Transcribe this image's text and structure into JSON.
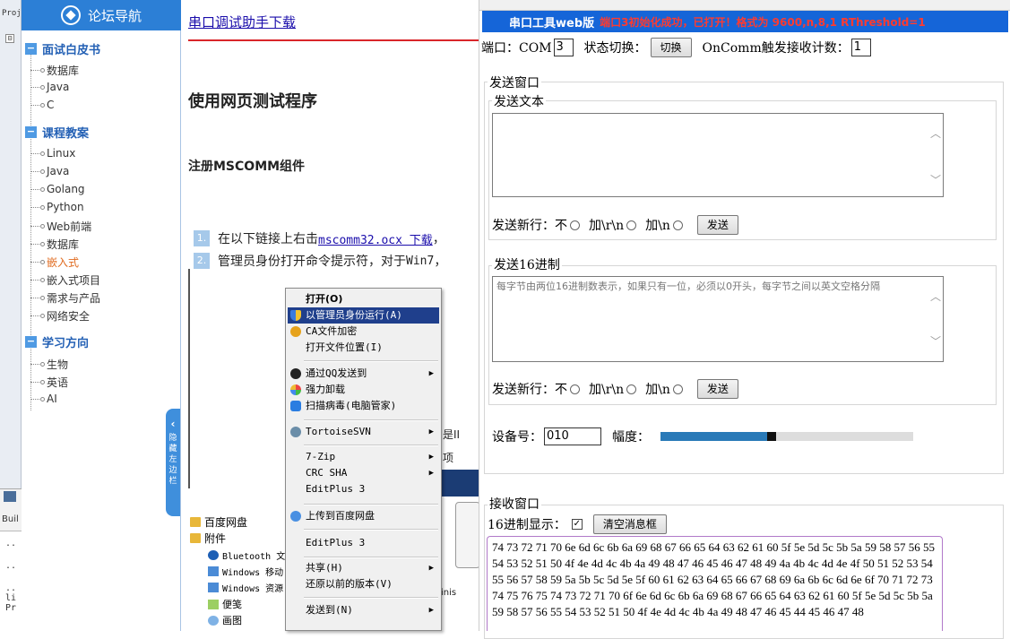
{
  "ide": {
    "panel_tab_top": "Proj",
    "build_tab": "Buil",
    "bottom_rows": [
      "..",
      "..",
      "..",
      "li",
      "Pr"
    ]
  },
  "sidebar": {
    "title": "论坛导航",
    "categories": [
      {
        "label": "面试白皮书",
        "items": [
          "数据库",
          "Java",
          "C"
        ]
      },
      {
        "label": "课程教案",
        "items": [
          "Linux",
          "Java",
          "Golang",
          "Python",
          "Web前端",
          "数据库",
          "嵌入式",
          "嵌入式项目",
          "需求与产品",
          "网络安全"
        ]
      },
      {
        "label": "学习方向",
        "items": [
          "生物",
          "英语",
          "AI"
        ]
      }
    ],
    "active_item": "嵌入式",
    "toggle_label": "隐藏左边栏"
  },
  "article": {
    "download_link": "串口调试助手下载",
    "heading": "使用网页测试程序",
    "subheading": "注册MSCOMM组件",
    "steps": [
      {
        "num": "1.",
        "text": "在以下链接上右击",
        "link": "mscomm32.ocx 下载",
        "tail": "，"
      },
      {
        "num": "2.",
        "text": "管理员身份打开命令提示符，对于",
        "code": "Win7",
        "tail": "，"
      }
    ],
    "fragments": {
      "f1": "是II",
      "f2": "项",
      "f3": "inis"
    }
  },
  "explorer": {
    "items": [
      "百度网盘",
      "附件",
      "Bluetooth 文",
      "Windows 移动",
      "Windows 资源",
      "便笺",
      "画图"
    ]
  },
  "context_menu": {
    "items": [
      {
        "label": "打开(O)",
        "bold": true
      },
      {
        "label": "以管理员身份运行(A)",
        "icon": "shield-icon",
        "highlighted": true
      },
      {
        "label": "CA文件加密",
        "icon": "key-icon"
      },
      {
        "label": "打开文件位置(I)"
      },
      {
        "label": "通过QQ发送到",
        "icon": "qq-icon",
        "submenu": true
      },
      {
        "label": "强力卸载",
        "icon": "uninstall-icon"
      },
      {
        "label": "扫描病毒(电脑管家)",
        "icon": "scan-icon"
      },
      {
        "label": "TortoiseSVN",
        "icon": "svn-icon",
        "submenu": true
      },
      {
        "label": "7-Zip",
        "submenu": true
      },
      {
        "label": "CRC SHA",
        "submenu": true
      },
      {
        "label": "EditPlus 3"
      },
      {
        "label": "上传到百度网盘",
        "icon": "cloud-icon"
      },
      {
        "label": "EditPlus 3"
      },
      {
        "label": "共享(H)",
        "submenu": true
      },
      {
        "label": "还原以前的版本(V)"
      },
      {
        "label": "发送到(N)",
        "submenu": true
      }
    ]
  },
  "tool": {
    "title": "串口工具web版",
    "status": "端口3初始化成功，已打开！格式为 9600,n,8,1 RThreshold=1",
    "port_label": "端口：COM",
    "port_value": "3",
    "toggle_label": "状态切换：",
    "toggle_button": "切换",
    "oncomm_label": "OnComm触发接收计数：",
    "oncomm_value": "1",
    "send_window": "发送窗口",
    "send_text_legend": "发送文本",
    "send_text_value": "",
    "newline_label": "发送新行：",
    "newline_opts": [
      "不",
      "加\\r\\n",
      "加\\n"
    ],
    "send_button": "发送",
    "hex_legend": "发送16进制",
    "hex_placeholder": "每字节由两位16进制数表示，如果只有一位，必须以0开头，每字节之间以英文空格分隔",
    "device_label": "设备号：",
    "device_value": "010",
    "amplitude_label": "幅度：",
    "amplitude_fraction": 0.44,
    "recv_window": "接收窗口",
    "hex_display_label": "16进制显示：",
    "hex_display_checked": true,
    "clear_button": "清空消息框",
    "recv_text": "74 73 72 71 70 6e 6d 6c 6b 6a 69 68 67 66 65 64 63 62 61 60 5f 5e 5d 5c 5b 5a 59 58 57 56 55 54 53 52 51 50 4f 4e 4d 4c 4b 4a 49 48 47 46 45 46 47 48 49 4a 4b 4c 4d 4e 4f 50 51 52 53 54 55 56 57 58 59 5a 5b 5c 5d 5e 5f 60 61 62 63 64 65 66 67 68 69 6a 6b 6c 6d 6e 6f 70 71 72 73 74 75 76 75 74 73 72 71 70 6f 6e 6d 6c 6b 6a 69 68 67 66 65 64 63 62 61 60 5f 5e 5d 5c 5b 5a 59 58 57 56 55 54 53 52 51 50 4f 4e 4d 4c 4b 4a 49 48 47 46 45 44 45 46 47 48"
  }
}
